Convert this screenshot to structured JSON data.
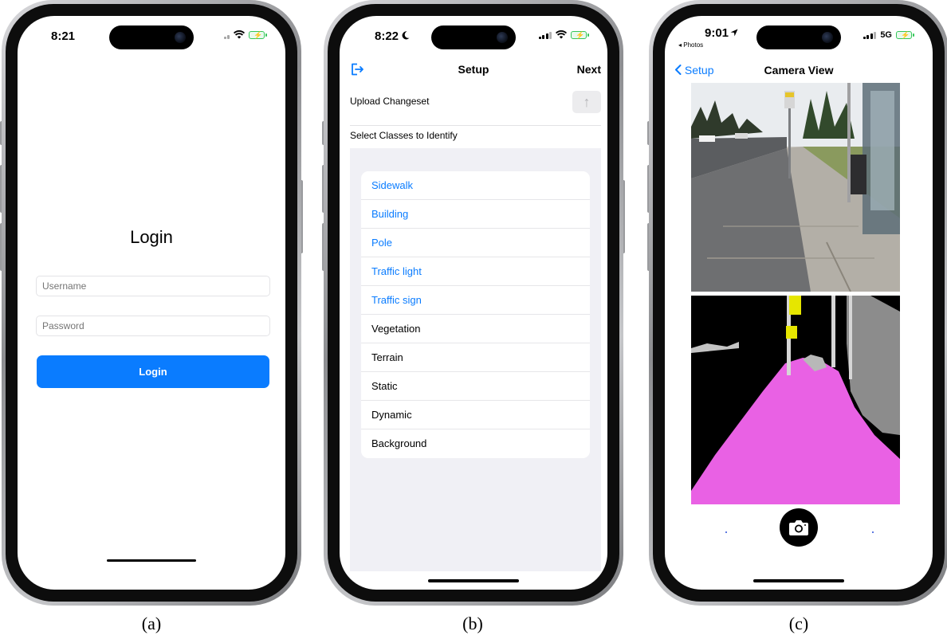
{
  "screens": {
    "a": {
      "status_time": "8:21",
      "title": "Login",
      "username_placeholder": "Username",
      "password_placeholder": "Password",
      "login_button": "Login",
      "caption": "(a)"
    },
    "b": {
      "status_time": "8:22",
      "nav_title": "Setup",
      "next_label": "Next",
      "upload_label": "Upload Changeset",
      "select_label": "Select Classes to Identify",
      "classes": [
        {
          "label": "Sidewalk",
          "selected": true
        },
        {
          "label": "Building",
          "selected": true
        },
        {
          "label": "Pole",
          "selected": true
        },
        {
          "label": "Traffic light",
          "selected": true
        },
        {
          "label": "Traffic sign",
          "selected": true
        },
        {
          "label": "Vegetation",
          "selected": false
        },
        {
          "label": "Terrain",
          "selected": false
        },
        {
          "label": "Static",
          "selected": false
        },
        {
          "label": "Dynamic",
          "selected": false
        },
        {
          "label": "Background",
          "selected": false
        }
      ],
      "caption": "(b)"
    },
    "c": {
      "status_time": "9:01",
      "back_app": "◂ Photos",
      "network": "5G",
      "back_label": "Setup",
      "nav_title": "Camera View",
      "caption": "(c)"
    }
  },
  "colors": {
    "accent": "#0a7cff",
    "battery": "#34c759",
    "sidewalk_mask": "#e961e4",
    "pole_mask": "#d6d6d6",
    "sign_mask": "#e6e600",
    "building_mask": "#8c8c8c"
  },
  "icons": [
    "logout-icon",
    "upload-arrow-icon",
    "chevron-left-icon",
    "camera-icon",
    "wifi-icon",
    "signal-icon",
    "battery-icon",
    "moon-icon",
    "location-arrow-icon"
  ]
}
